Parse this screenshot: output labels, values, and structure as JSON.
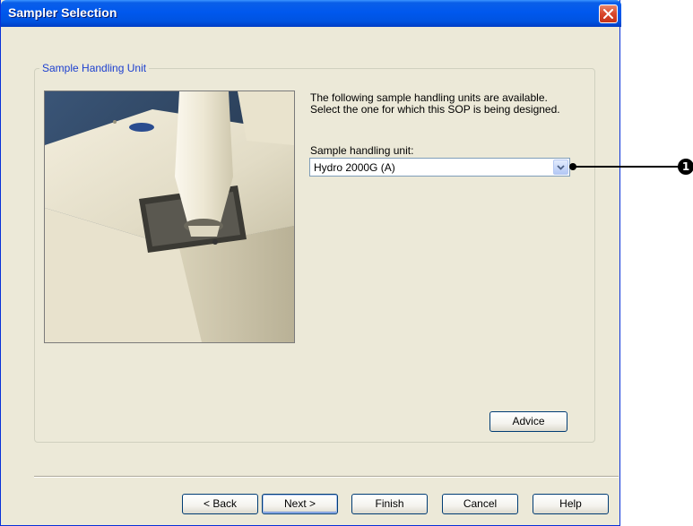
{
  "window": {
    "title": "Sampler Selection"
  },
  "group": {
    "legend": "Sample Handling Unit"
  },
  "intro_text": "The following sample handling units are available.\nSelect the one for which this SOP is being designed.",
  "field": {
    "label": "Sample handling unit:",
    "selected_value": "Hydro 2000G (A)"
  },
  "buttons": {
    "advice": "Advice",
    "back": "< Back",
    "next": "Next >",
    "finish": "Finish",
    "cancel": "Cancel",
    "help": "Help"
  },
  "callout": {
    "number": "1"
  },
  "colors": {
    "titlebar": "#0058ee",
    "dialog_bg": "#ece9d8",
    "legend_text": "#1c3fcf",
    "close_button": "#d9472b"
  },
  "icons": {
    "close": "close-icon",
    "dropdown": "chevron-down-icon"
  }
}
